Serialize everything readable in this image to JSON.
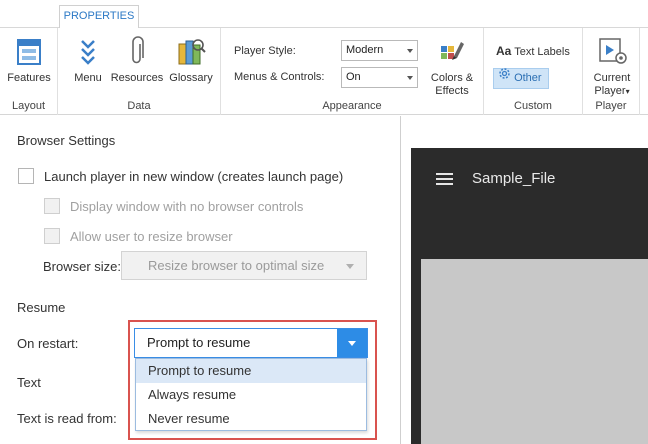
{
  "ribbon": {
    "tab": "PROPERTIES",
    "groups": {
      "layout": {
        "label": "Layout",
        "features": "Features"
      },
      "data": {
        "label": "Data",
        "menu": "Menu",
        "resources": "Resources",
        "glossary": "Glossary"
      },
      "appearance": {
        "label": "Appearance",
        "player_style_label": "Player Style:",
        "player_style_value": "Modern",
        "menus_controls_label": "Menus & Controls:",
        "menus_controls_value": "On",
        "colors_effects_line1": "Colors &",
        "colors_effects_line2": "Effects"
      },
      "custom": {
        "label": "Custom",
        "text_labels_prefix": "Aa",
        "text_labels": "Text Labels",
        "other": "Other"
      },
      "player": {
        "label": "Player",
        "current_line1": "Current",
        "current_line2": "Player"
      }
    }
  },
  "browser_settings": {
    "title": "Browser Settings",
    "launch_new_window": "Launch player in new window (creates launch page)",
    "no_browser_controls": "Display window with no browser controls",
    "allow_resize": "Allow user to resize browser",
    "browser_size_label": "Browser size:",
    "browser_size_value": "Resize browser to optimal size"
  },
  "resume": {
    "title": "Resume",
    "on_restart_label": "On restart:",
    "on_restart_value": "Prompt to resume",
    "options": [
      "Prompt to resume",
      "Always resume",
      "Never resume"
    ]
  },
  "text_section": {
    "title": "Text",
    "read_from_label": "Text is read from:"
  },
  "preview": {
    "title": "Sample_File"
  },
  "colors": {
    "accent": "#2d8ce6",
    "highlight": "#d9534f",
    "preview_bg": "#2b2b2b"
  }
}
